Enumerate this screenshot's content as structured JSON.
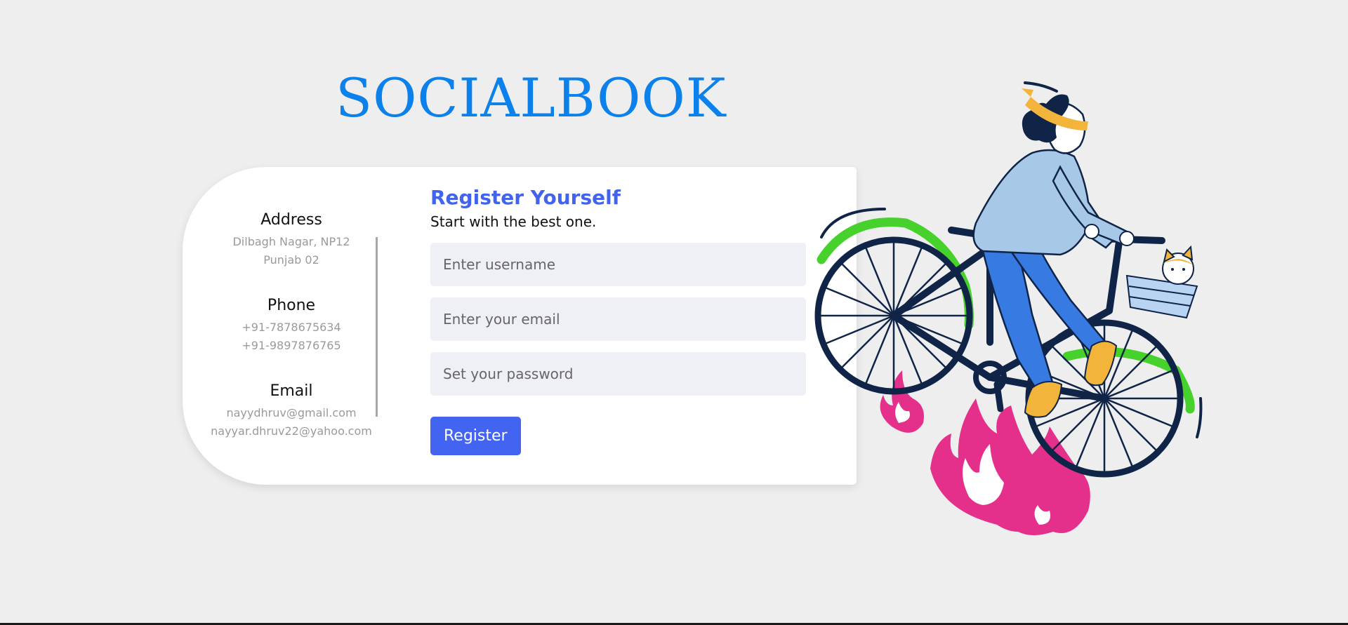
{
  "brand": {
    "title": "SOCIALBOOK"
  },
  "contact": {
    "address": {
      "heading": "Address",
      "lines": [
        "Dilbagh Nagar, NP12",
        "Punjab 02"
      ]
    },
    "phone": {
      "heading": "Phone",
      "lines": [
        "+91-7878675634",
        "+91-9897876765"
      ]
    },
    "email": {
      "heading": "Email",
      "lines": [
        "nayydhruv@gmail.com",
        "nayyar.dhruv22@yahoo.com"
      ]
    }
  },
  "form": {
    "title": "Register Yourself",
    "subtitle": "Start with the best one.",
    "username": {
      "placeholder": "Enter username",
      "value": ""
    },
    "email": {
      "placeholder": "Enter your email",
      "value": ""
    },
    "password": {
      "placeholder": "Set your password",
      "value": ""
    },
    "submit_label": "Register"
  },
  "illustration": {
    "icon": "woman-riding-bicycle-illustration"
  },
  "colors": {
    "brand": "#0c81eb",
    "accent": "#4264f0",
    "page_bg": "#eeeeef",
    "input_bg": "#efeff6"
  }
}
